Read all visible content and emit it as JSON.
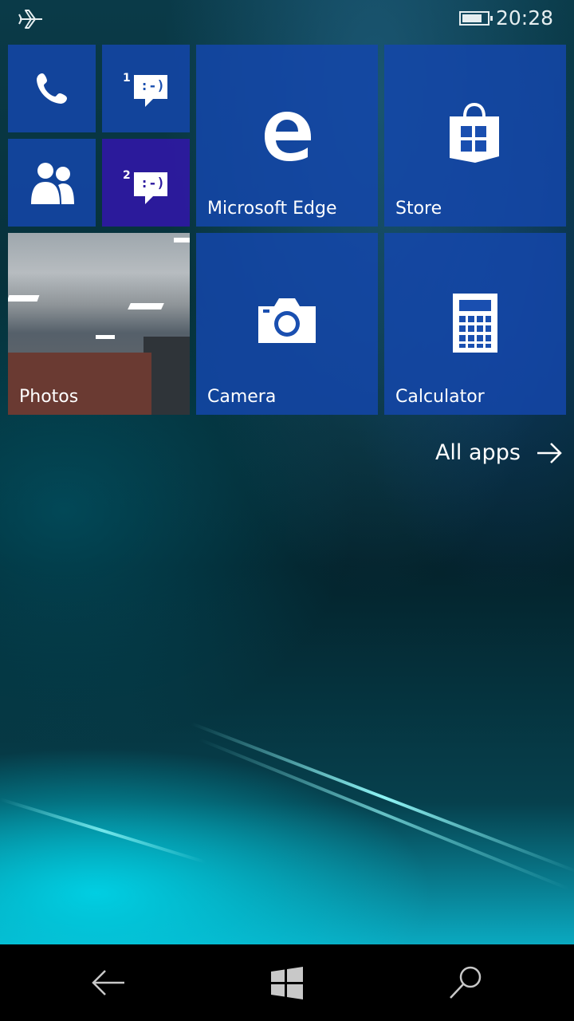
{
  "status": {
    "time": "20:28",
    "battery_level": 0.8,
    "airplane_icon": "airplane-icon"
  },
  "tiles": {
    "phone": {
      "icon": "phone-icon"
    },
    "messaging1": {
      "badge": "1",
      "icon": "messaging-icon",
      "emoticon": ":-)"
    },
    "people": {
      "icon": "people-icon"
    },
    "messaging2": {
      "badge": "2",
      "icon": "messaging-icon",
      "emoticon": ":-)"
    },
    "edge": {
      "label": "Microsoft Edge",
      "icon": "edge-icon"
    },
    "store": {
      "label": "Store",
      "icon": "store-icon"
    },
    "photos": {
      "label": "Photos"
    },
    "camera": {
      "label": "Camera",
      "icon": "camera-icon"
    },
    "calculator": {
      "label": "Calculator",
      "icon": "calculator-icon"
    }
  },
  "all_apps": {
    "label": "All apps",
    "icon": "arrow-right-icon"
  },
  "navbar": {
    "back_icon": "back-arrow-icon",
    "start_icon": "windows-logo-icon",
    "search_icon": "search-icon"
  },
  "colors": {
    "tile_blue": "#1a4fb0",
    "tile_purple": "#2d19a0",
    "navbar": "#000000"
  }
}
